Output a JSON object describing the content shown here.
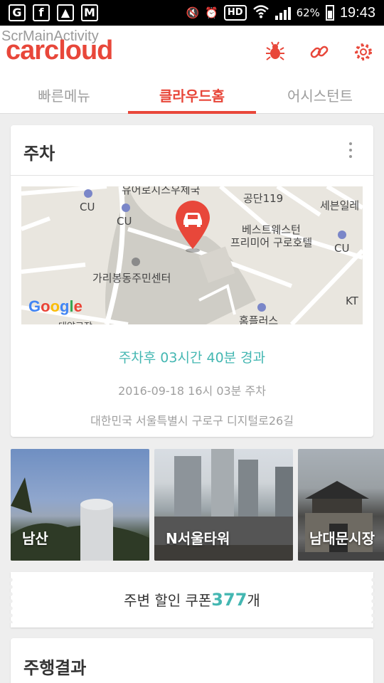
{
  "status_bar": {
    "battery": "62%",
    "time": "19:43",
    "hd": "HD"
  },
  "debug_label": "ScrMainActivity",
  "app": {
    "logo": "carcloud",
    "accent": "#e8473a",
    "teal": "#44b7b2"
  },
  "header_icons": [
    "bug-icon",
    "link-icon",
    "settings-icon"
  ],
  "tabs": [
    {
      "label": "빠른메뉴",
      "active": false
    },
    {
      "label": "클라우드홈",
      "active": true
    },
    {
      "label": "어시스턴트",
      "active": false
    }
  ],
  "parking": {
    "title": "주차",
    "elapsed": "주차후 03시간 40분 경과",
    "parked_at": "2016-09-18 16시 03분 주차",
    "address": "대한민국 서울특별시 구로구 디지털로26길",
    "map": {
      "labels": [
        "유어로지스우체국",
        "공단119",
        "세븐일레",
        "CU",
        "CU",
        "베스트웨스턴",
        "프리미어 구로호텔",
        "CU",
        "가리봉동주민센터",
        "KT",
        "홈플러스",
        "대양교장"
      ],
      "provider": "Google"
    }
  },
  "places": [
    {
      "label": "남산"
    },
    {
      "label": "N서울타워"
    },
    {
      "label": "남대문시장"
    }
  ],
  "coupon": {
    "prefix": "주변 할인 쿠폰",
    "count": "377",
    "suffix": "개"
  },
  "driving": {
    "title": "주행결과"
  }
}
